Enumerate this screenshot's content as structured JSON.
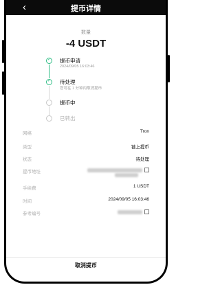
{
  "header": {
    "back": "‹",
    "title": "提币详情"
  },
  "amount": {
    "label": "数量",
    "value": "-4 USDT"
  },
  "steps": [
    {
      "label": "提币申请",
      "sub": "2024/09/05 16:03:46"
    },
    {
      "label": "待处理",
      "sub": "您可在 1 分钟内取消提币"
    },
    {
      "label": "提币中"
    },
    {
      "label": "已转出"
    }
  ],
  "details": {
    "network": {
      "key": "网络",
      "value": "Tron"
    },
    "type": {
      "key": "类型",
      "value": "链上提币"
    },
    "status": {
      "key": "状态",
      "value": "待处理"
    },
    "address": {
      "key": "提币地址"
    },
    "fee": {
      "key": "手续费",
      "value": "1 USDT"
    },
    "time": {
      "key": "时间",
      "value": "2024/09/05 16:03:46"
    },
    "ref": {
      "key": "参考编号"
    }
  },
  "actions": {
    "cancel": "取消提币"
  },
  "colors": {
    "accent": "#2ebd85"
  }
}
